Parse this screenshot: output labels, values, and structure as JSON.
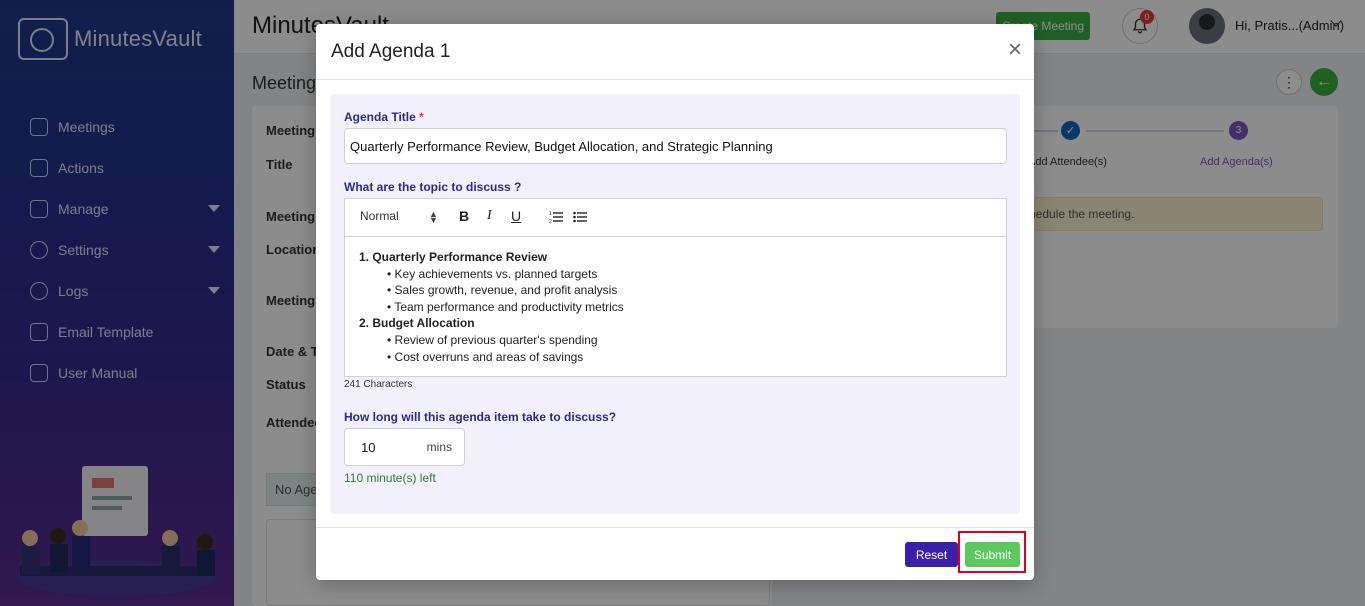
{
  "app": {
    "logo_text": "MinutesVault",
    "title": "MinutesVault"
  },
  "sidebar": {
    "items": [
      {
        "label": "Meetings",
        "icon": "meetings-icon",
        "has_caret": false
      },
      {
        "label": "Actions",
        "icon": "actions-icon",
        "has_caret": false
      },
      {
        "label": "Manage",
        "icon": "manage-icon",
        "has_caret": true
      },
      {
        "label": "Settings",
        "icon": "settings-icon",
        "has_caret": true
      },
      {
        "label": "Logs",
        "icon": "logs-icon",
        "has_caret": true
      },
      {
        "label": "Email Template",
        "icon": "email-icon",
        "has_caret": false
      },
      {
        "label": "User Manual",
        "icon": "manual-icon",
        "has_caret": false
      }
    ]
  },
  "topbar": {
    "create_label": "Create Meeting",
    "notification_count": "0",
    "user_name": "Hi, Pratis...(Admin)"
  },
  "background": {
    "page_heading": "Meeting",
    "labels": {
      "meeting1": "Meeting",
      "title": "Title",
      "meeting2": "Meeting",
      "location": "Location",
      "meeting3": "Meeting",
      "datetime": "Date & Ti",
      "status": "Status",
      "attendees": "Attendee"
    },
    "no_agenda": "No Age",
    "steps": {
      "attendees_label": "Add Attendee(s)",
      "agenda_label": "Add Agenda(s)",
      "agenda_num": "3"
    },
    "warning_text": "hedule the meeting."
  },
  "modal": {
    "title": "Add Agenda 1",
    "close_symbol": "×",
    "agenda_title_label": "Agenda Title",
    "required_mark": "*",
    "agenda_title_value": "Quarterly Performance Review, Budget Allocation, and Strategic Planning",
    "topic_label": "What are the topic to discuss ?",
    "toolbar": {
      "format_value": "Normal",
      "bold": "B",
      "italic": "I",
      "underline": "U"
    },
    "content": {
      "h1": "1. Quarterly Performance Review",
      "b1": "• Key achievements vs. planned targets",
      "b2": "• Sales growth, revenue, and profit analysis",
      "b3": "• Team performance and productivity metrics",
      "h2": "2. Budget Allocation",
      "b4": "• Review of previous quarter's spending",
      "b5": "• Cost overruns and areas of savings"
    },
    "char_count": "241 Characters",
    "duration_label": "How long will this agenda item take to discuss?",
    "duration_value": "10",
    "duration_unit": "mins",
    "remaining": "110 minute(s) left",
    "reset_label": "Reset",
    "submit_label": "Submit"
  },
  "colors": {
    "submit": "#5cc85f",
    "reset": "#3b1fa8",
    "highlight": "#e0001b",
    "label": "#2b2a8a"
  }
}
